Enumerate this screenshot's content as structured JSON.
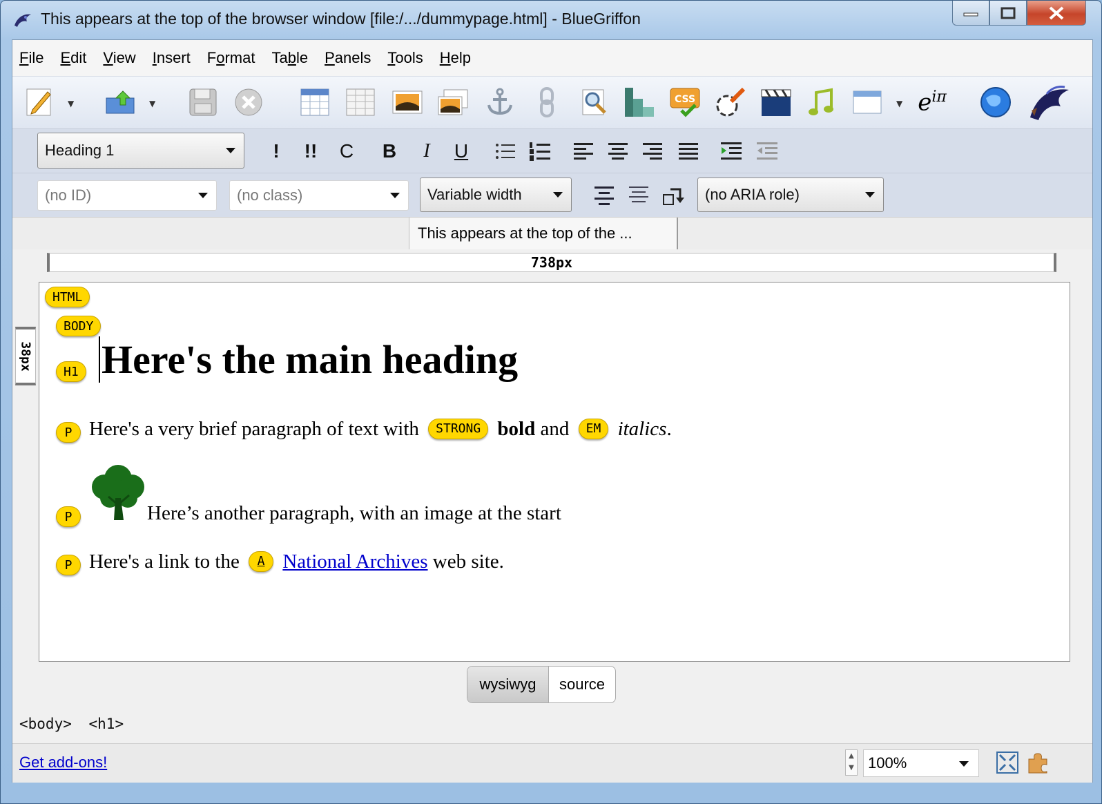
{
  "window": {
    "title": "This appears at the top of the browser window [file:/.../dummypage.html] - BlueGriffon",
    "controls": [
      "minimize",
      "maximize",
      "close"
    ]
  },
  "menu": [
    {
      "label": "File",
      "accel": "F",
      "rest": "ile"
    },
    {
      "label": "Edit",
      "accel": "E",
      "rest": "dit"
    },
    {
      "label": "View",
      "accel": "V",
      "rest": "iew"
    },
    {
      "label": "Insert",
      "accel": "I",
      "rest": "nsert"
    },
    {
      "label": "Format",
      "pre": "F",
      "accel": "o",
      "rest": "rmat"
    },
    {
      "label": "Table",
      "pre": "Ta",
      "accel": "b",
      "rest": "le"
    },
    {
      "label": "Panels",
      "accel": "P",
      "rest": "anels"
    },
    {
      "label": "Tools",
      "accel": "T",
      "rest": "ools"
    },
    {
      "label": "Help",
      "accel": "H",
      "rest": "elp"
    }
  ],
  "toolbar": {
    "icons": [
      "new-document-icon",
      "publish-icon",
      "save-icon",
      "stop-icon",
      "insert-table-icon",
      "table-grid-icon",
      "insert-image-icon",
      "image-gallery-icon",
      "anchor-icon",
      "link-icon",
      "spellcheck-icon",
      "blocks-icon",
      "css-icon",
      "style-brush-icon",
      "video-icon",
      "audio-icon",
      "form-icon",
      "math-icon",
      "web-preview-icon",
      "griffon-logo-icon"
    ],
    "math_label": "e",
    "math_sup": "iπ",
    "css_label": "CSS"
  },
  "format_bar": {
    "paragraph_style": "Heading 1",
    "buttons": [
      {
        "name": "emphasis-button",
        "label": "!"
      },
      {
        "name": "strong-emphasis-button",
        "label": "!!"
      },
      {
        "name": "code-button",
        "label": "C"
      },
      {
        "name": "bold-button",
        "label": "B"
      },
      {
        "name": "italic-button",
        "label": "I"
      },
      {
        "name": "underline-button",
        "label": "U"
      }
    ]
  },
  "attr_bar": {
    "id_placeholder": "(no ID)",
    "class_placeholder": "(no class)",
    "width_mode": "Variable width",
    "aria_role": "(no ARIA role)"
  },
  "tabs": {
    "document_tab": "This appears at the top of the ..."
  },
  "rulers": {
    "horizontal": "738px",
    "vertical": "38px"
  },
  "document": {
    "tags": {
      "html": "HTML",
      "body": "BODY",
      "h1": "H1",
      "p": "P",
      "strong": "STRONG",
      "em": "EM",
      "a": "A"
    },
    "heading": "Here's the main heading",
    "p1": {
      "before": "Here's a very brief paragraph of text with",
      "bold": "bold",
      "middle": "and",
      "italic": "italics",
      "after": "."
    },
    "p2": "Here’s another paragraph, with an image at the start",
    "p3": {
      "before": "Here's a link to the",
      "link": "National Archives",
      "after": "web site."
    }
  },
  "view_tabs": {
    "wysiwyg": "wysiwyg",
    "source": "source",
    "active": "wysiwyg"
  },
  "breadcrumb": [
    "<body>",
    "<h1>"
  ],
  "status": {
    "addons_link": "Get add-ons!",
    "zoom": "100%"
  }
}
